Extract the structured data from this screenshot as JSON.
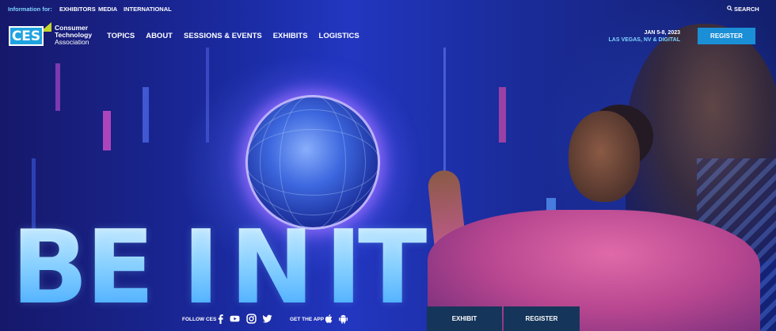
{
  "topbar": {
    "info_label": "Information for:",
    "links": [
      "EXHIBITORS",
      "MEDIA",
      "INTERNATIONAL"
    ],
    "search_label": "SEARCH"
  },
  "logo": {
    "mark": "CES",
    "line1": "Consumer",
    "line2": "Technology",
    "line3": "Association"
  },
  "nav": {
    "items": [
      "TOPICS",
      "ABOUT",
      "SESSIONS & EVENTS",
      "EXHIBITS",
      "LOGISTICS"
    ]
  },
  "event": {
    "dates": "JAN 5-8, 2023",
    "location": "LAS VEGAS, NV & DIGITAL"
  },
  "header": {
    "register_label": "REGISTER"
  },
  "hero": {
    "letters": [
      "B",
      "E",
      "I",
      "N",
      "I",
      "T"
    ]
  },
  "footer": {
    "follow_label": "FOLLOW CES",
    "social_icons": [
      "facebook-icon",
      "youtube-icon",
      "instagram-icon",
      "twitter-icon"
    ],
    "app_label": "GET THE APP",
    "app_icons": [
      "apple-icon",
      "android-icon"
    ],
    "exhibit_label": "EXHIBIT",
    "register_label": "REGISTER"
  },
  "colors": {
    "accent_blue": "#1b8fd6",
    "light_blue_text": "#7fd3ff",
    "logo_green": "#c7d62d",
    "bottom_button": "#15355a"
  }
}
